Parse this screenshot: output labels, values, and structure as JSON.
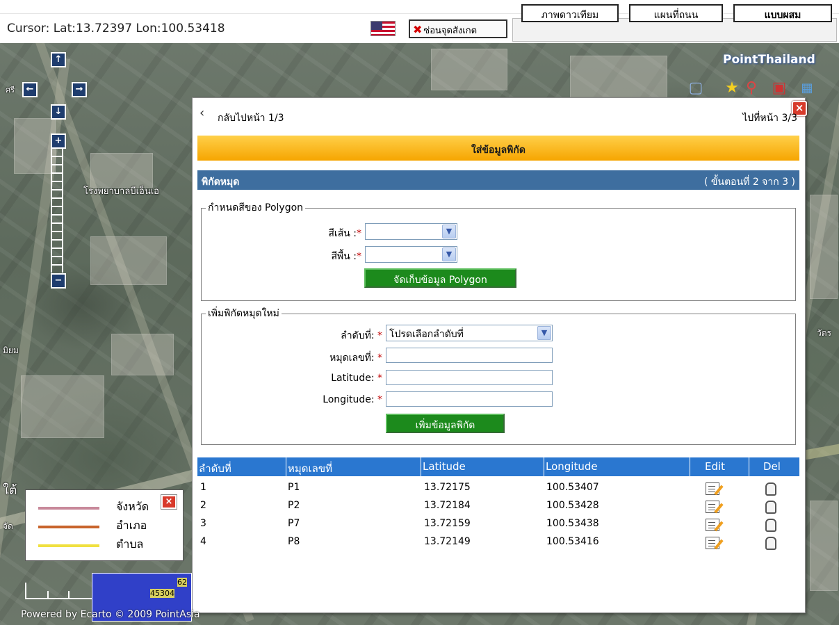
{
  "cursor": {
    "readout": "Cursor: Lat:13.72397  Lon:100.53418"
  },
  "toolbar": {
    "flag_icon": "us-flag-icon",
    "hide_label": "ซ่อนจุดสังเกต",
    "modes": [
      "ภาพดาวเทียม",
      "แผนที่ถนน",
      "แบบผสม"
    ]
  },
  "map": {
    "brand": "PointThailand",
    "labels": {
      "top_left": "ศรี",
      "hospital": "โรงพยาบาลบีเอ็นเอ",
      "left": "มิยม",
      "right": "วัดร",
      "side": "จัด",
      "side2": "ใต้"
    },
    "copyright": "Powered by Ecarto © 2009 PointAsia",
    "minimap_numbers": [
      "62",
      "45304"
    ]
  },
  "dialog": {
    "back": "กลับไปหน้า 1/3",
    "forward": "ไปที่หน้า 3/3",
    "header": "ใส่ข้อมูลพิกัด",
    "section_title": "พิกัดหมุด",
    "step": "( ขั้นตอนที่ 2 จาก 3 )",
    "polygon": {
      "legend": "กำหนดสีของ Polygon",
      "line_color_label": "สีเส้น :",
      "fill_color_label": "สีพื้น :",
      "line_color_value": "",
      "fill_color_value": "",
      "save_button": "จัดเก็บข้อมูล Polygon"
    },
    "new_pin": {
      "legend": "เพิ่มพิกัดหมุดใหม่",
      "order_label": "ลำดับที่:",
      "order_value": "โปรดเลือกลำดับที่",
      "pin_no_label": "หมุดเลขที่:",
      "lat_label": "Latitude:",
      "lon_label": "Longitude:",
      "add_button": "เพิ่มข้อมูลพิกัด"
    },
    "table": {
      "headers": [
        "ลำดับที่",
        "หมุดเลขที่",
        "Latitude",
        "Longitude",
        "Edit",
        "Del"
      ],
      "rows": [
        {
          "order": "1",
          "pin": "P1",
          "lat": "13.72175",
          "lon": "100.53407"
        },
        {
          "order": "2",
          "pin": "P2",
          "lat": "13.72184",
          "lon": "100.53428"
        },
        {
          "order": "3",
          "pin": "P7",
          "lat": "13.72159",
          "lon": "100.53438"
        },
        {
          "order": "4",
          "pin": "P8",
          "lat": "13.72149",
          "lon": "100.53416"
        }
      ]
    }
  },
  "legend": {
    "items": [
      {
        "label": "จังหวัด",
        "color": "#c8899a"
      },
      {
        "label": "อำเภอ",
        "color": "#c8642c"
      },
      {
        "label": "ตำบล",
        "color": "#f0e040"
      }
    ]
  }
}
